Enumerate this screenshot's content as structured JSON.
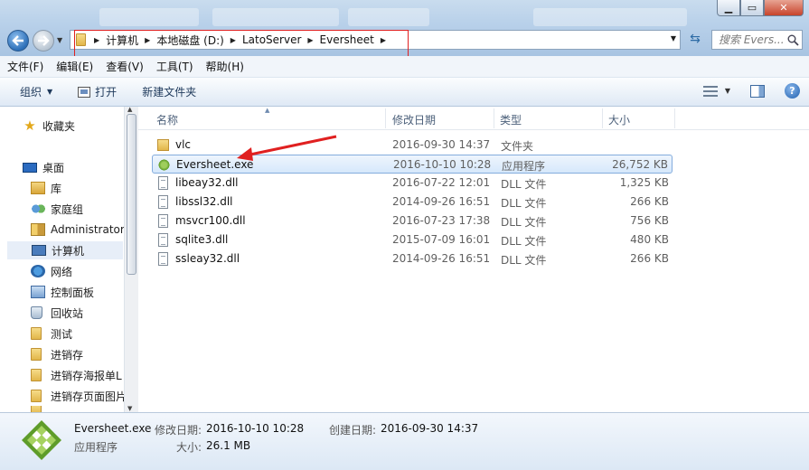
{
  "address": {
    "crumbs": [
      "计算机",
      "本地磁盘 (D:)",
      "LatoServer",
      "Eversheet"
    ],
    "search_placeholder": "搜索 Evers..."
  },
  "menu": [
    "文件(F)",
    "编辑(E)",
    "查看(V)",
    "工具(T)",
    "帮助(H)"
  ],
  "toolbar": {
    "organize": "组织",
    "open": "打开",
    "new_folder": "新建文件夹"
  },
  "nav": {
    "favorites": "收藏夹",
    "desktop": "桌面",
    "library": "库",
    "homegroup": "家庭组",
    "administrator": "Administrator",
    "computer": "计算机",
    "network": "网络",
    "control_panel": "控制面板",
    "recycle_bin": "回收站",
    "folders": [
      "测试",
      "进销存",
      "进销存海报单L",
      "进销存页面图片"
    ]
  },
  "columns": {
    "name": "名称",
    "date": "修改日期",
    "type": "类型",
    "size": "大小"
  },
  "files": [
    {
      "name": "vlc",
      "date": "2016-09-30 14:37",
      "type": "文件夹",
      "size": "",
      "icon": "folder-icon"
    },
    {
      "name": "Eversheet.exe",
      "date": "2016-10-10 10:28",
      "type": "应用程序",
      "size": "26,752 KB",
      "icon": "exe-icon"
    },
    {
      "name": "libeay32.dll",
      "date": "2016-07-22 12:01",
      "type": "DLL 文件",
      "size": "1,325 KB",
      "icon": "dll-icon"
    },
    {
      "name": "libssl32.dll",
      "date": "2014-09-26 16:51",
      "type": "DLL 文件",
      "size": "266 KB",
      "icon": "dll-icon"
    },
    {
      "name": "msvcr100.dll",
      "date": "2016-07-23 17:38",
      "type": "DLL 文件",
      "size": "756 KB",
      "icon": "dll-icon"
    },
    {
      "name": "sqlite3.dll",
      "date": "2015-07-09 16:01",
      "type": "DLL 文件",
      "size": "480 KB",
      "icon": "dll-icon"
    },
    {
      "name": "ssleay32.dll",
      "date": "2014-09-26 16:51",
      "type": "DLL 文件",
      "size": "266 KB",
      "icon": "dll-icon"
    }
  ],
  "details": {
    "filename": "Eversheet.exe",
    "modified_label": "修改日期:",
    "modified_value": "2016-10-10 10:28",
    "created_label": "创建日期:",
    "created_value": "2016-09-30 14:37",
    "type": "应用程序",
    "size_label": "大小:",
    "size_value": "26.1 MB"
  },
  "colors": {
    "selection_border": "#84acdd",
    "annotation_red": "#e02020"
  }
}
